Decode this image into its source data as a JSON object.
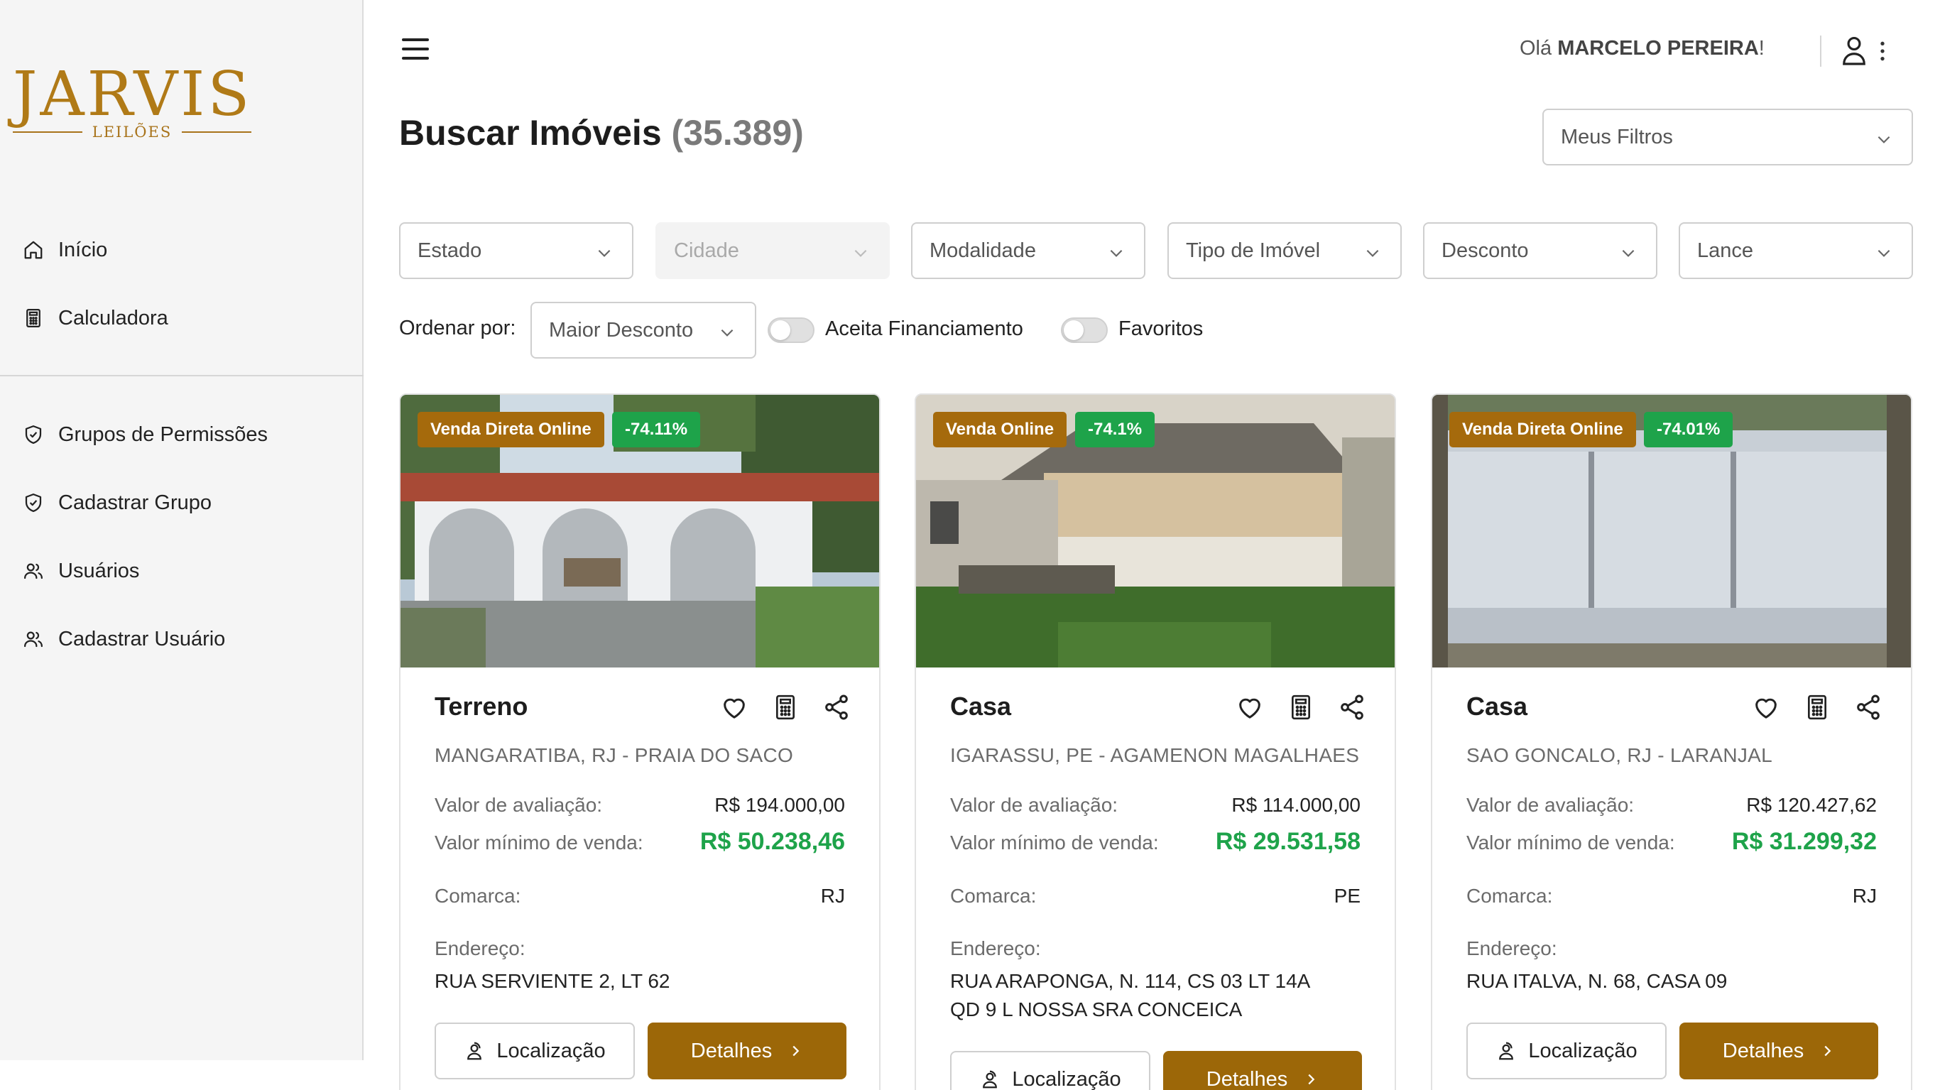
{
  "brand": {
    "name": "JARVIS",
    "tagline": "LEILÕES",
    "color": "#b07a17"
  },
  "sidebar": {
    "items_top": [
      {
        "label": "Início",
        "icon": "home-icon"
      },
      {
        "label": "Calculadora",
        "icon": "calculator-icon"
      }
    ],
    "items_admin": [
      {
        "label": "Grupos de Permissões",
        "icon": "shield-icon"
      },
      {
        "label": "Cadastrar Grupo",
        "icon": "shield-icon"
      },
      {
        "label": "Usuários",
        "icon": "users-icon"
      },
      {
        "label": "Cadastrar Usuário",
        "icon": "users-icon"
      }
    ]
  },
  "header": {
    "greeting_prefix": "Olá ",
    "user_name": "MARCELO PEREIRA",
    "greeting_suffix": "!"
  },
  "page": {
    "title": "Buscar Imóveis",
    "count": "(35.389)"
  },
  "saved_filters": {
    "placeholder": "Meus Filtros"
  },
  "filters": [
    {
      "label": "Estado",
      "disabled": false
    },
    {
      "label": "Cidade",
      "disabled": true
    },
    {
      "label": "Modalidade",
      "disabled": false
    },
    {
      "label": "Tipo de Imóvel",
      "disabled": false
    },
    {
      "label": "Desconto",
      "disabled": false
    },
    {
      "label": "Lance",
      "disabled": false
    }
  ],
  "sort": {
    "label": "Ordenar por:",
    "value": "Maior Desconto"
  },
  "toggles": [
    {
      "label": "Aceita Financiamento",
      "on": false
    },
    {
      "label": "Favoritos",
      "on": false
    }
  ],
  "card_labels": {
    "valuation": "Valor de avaliação:",
    "min_sale": "Valor mínimo de venda:",
    "district": "Comarca:",
    "address": "Endereço:",
    "location_button": "Localização",
    "details_button": "Detalhes"
  },
  "colors": {
    "accent": "#9c6708",
    "discount": "#1ea34a",
    "modality_badge": "#a56a0c"
  },
  "cards": [
    {
      "modality": "Venda Direta Online",
      "discount": "-74.11%",
      "type": "Terreno",
      "location": "MANGARATIBA, RJ - PRAIA DO SACO",
      "valuation": "R$ 194.000,00",
      "min_sale": "R$ 50.238,46",
      "district": "RJ",
      "address": "RUA SERVIENTE 2, LT 62"
    },
    {
      "modality": "Venda Online",
      "discount": "-74.1%",
      "type": "Casa",
      "location": "IGARASSU, PE - AGAMENON MAGALHAES",
      "valuation": "R$ 114.000,00",
      "min_sale": "R$ 29.531,58",
      "district": "PE",
      "address": "RUA ARAPONGA, N. 114, CS 03 LT 14A QD 9 L NOSSA SRA CONCEICA"
    },
    {
      "modality": "Venda Direta Online",
      "discount": "-74.01%",
      "type": "Casa",
      "location": "SAO GONCALO, RJ - LARANJAL",
      "valuation": "R$ 120.427,62",
      "min_sale": "R$ 31.299,32",
      "district": "RJ",
      "address": "RUA ITALVA, N. 68, CASA 09"
    }
  ]
}
